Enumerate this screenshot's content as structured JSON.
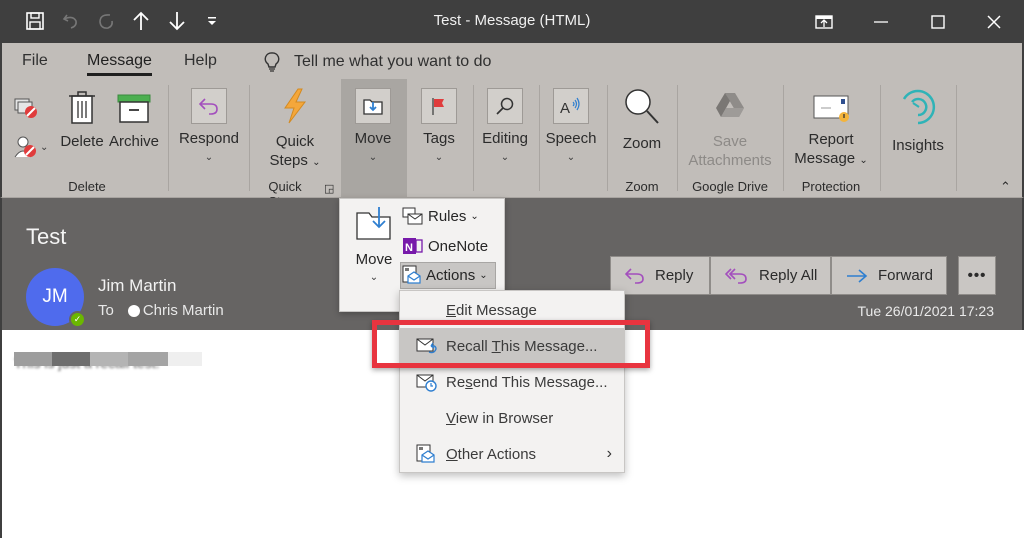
{
  "window": {
    "title": "Test  -  Message (HTML)",
    "quick_access": [
      "save-icon",
      "undo-icon",
      "redo-icon",
      "up-arrow-icon",
      "down-arrow-icon",
      "customize-icon"
    ],
    "controls": [
      "restore-ribbon-icon",
      "minimize-icon",
      "maximize-icon",
      "close-icon"
    ]
  },
  "tabs": [
    {
      "label": "File"
    },
    {
      "label": "Message",
      "active": true
    },
    {
      "label": "Help"
    }
  ],
  "tell_me": "Tell me what you want to do",
  "ribbon": {
    "delete_group": {
      "label": "Delete",
      "delete": "Delete",
      "archive": "Archive"
    },
    "respond": "Respond",
    "quick_steps": {
      "line1": "Quick",
      "line2": "Steps",
      "group_label": "Quick Steps"
    },
    "move": "Move",
    "tags": "Tags",
    "editing": "Editing",
    "speech": "Speech",
    "zoom": {
      "label": "Zoom",
      "group_label": "Zoom"
    },
    "google_drive": {
      "line1": "Save",
      "line2": "Attachments",
      "group_label": "Google Drive"
    },
    "report": {
      "line1": "Report",
      "line2": "Message",
      "group_label": "Protection"
    },
    "insights": "Insights"
  },
  "message": {
    "subject": "Test",
    "avatar_initials": "JM",
    "avatar_color": "#4f6bed",
    "sender": "Jim Martin",
    "to_label": "To",
    "recipient": "Chris Martin",
    "date": "Tue 26/01/2021 17:23",
    "actions": {
      "reply": "Reply",
      "reply_all": "Reply All",
      "forward": "Forward",
      "more": "•••"
    },
    "body_text": "This is just a recall test."
  },
  "move_dropdown": {
    "move": "Move",
    "rules": "Rules",
    "onenote": "OneNote",
    "actions": "Actions"
  },
  "actions_menu": [
    {
      "pre": "",
      "ul": "E",
      "post": "dit Message",
      "icon": ""
    },
    {
      "pre": "Recall ",
      "ul": "T",
      "post": "his Message...",
      "icon": "recall-message-icon",
      "highlighted": true
    },
    {
      "pre": "Re",
      "ul": "s",
      "post": "end This Message...",
      "icon": "resend-message-icon"
    },
    {
      "pre": "",
      "ul": "V",
      "post": "iew in Browser",
      "icon": ""
    },
    {
      "pre": "",
      "ul": "O",
      "post": "ther Actions",
      "icon": "other-actions-icon",
      "submenu": true
    }
  ],
  "highlight_color": "#e8343f"
}
